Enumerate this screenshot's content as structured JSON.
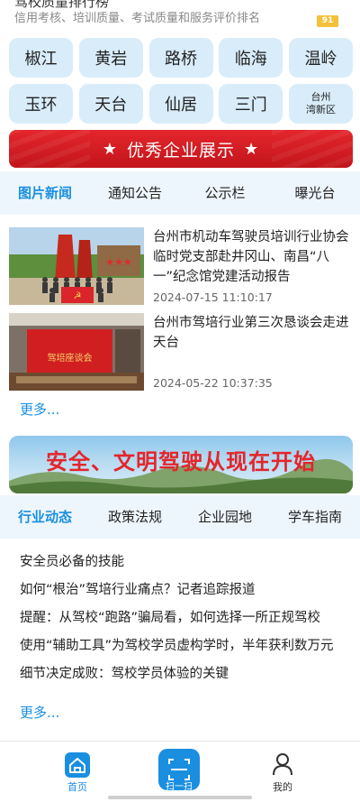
{
  "header": {
    "title": "驾校质量排行榜",
    "subtitle": "信用考核、培训质量、考试质量和服务评价排名",
    "badge": "91"
  },
  "regions": [
    {
      "label": "椒江"
    },
    {
      "label": "黄岩"
    },
    {
      "label": "路桥"
    },
    {
      "label": "临海"
    },
    {
      "label": "温岭"
    },
    {
      "label": "玉环"
    },
    {
      "label": "天台"
    },
    {
      "label": "仙居"
    },
    {
      "label": "三门"
    },
    {
      "label": "台州\n湾新区"
    }
  ],
  "showcase_banner": {
    "label": "优秀企业展示",
    "star": "★"
  },
  "news_tabs": [
    {
      "label": "图片新闻",
      "active": true
    },
    {
      "label": "通知公告",
      "active": false
    },
    {
      "label": "公示栏",
      "active": false
    },
    {
      "label": "曝光台",
      "active": false
    }
  ],
  "news": [
    {
      "title": "台州市机动车驾驶员培训行业协会临时党支部赴井冈山、南昌“八一”纪念馆党建活动报告",
      "date": "2024-07-15 11:10:17"
    },
    {
      "title": "台州市驾培行业第三次恳谈会走进天台",
      "date": "2024-05-22 10:37:35",
      "screen_text": "驾培座谈会"
    }
  ],
  "more_label": "更多...",
  "slogan_banner": {
    "text": "安全、文明驾驶从现在开始"
  },
  "industry_tabs": [
    {
      "label": "行业动态",
      "active": true
    },
    {
      "label": "政策法规",
      "active": false
    },
    {
      "label": "企业园地",
      "active": false
    },
    {
      "label": "学车指南",
      "active": false
    }
  ],
  "articles": [
    {
      "title": "安全员必备的技能"
    },
    {
      "title": "如何“根治”驾培行业痛点？记者追踪报道"
    },
    {
      "title": "提醒：从驾校“跑路”骗局看，如何选择一所正规驾校"
    },
    {
      "title": "使用“辅助工具”为驾校学员虚构学时，半年获利数万元"
    },
    {
      "title": "细节决定成败：驾校学员体验的关键"
    }
  ],
  "bottom_nav": {
    "home": {
      "label": "首页",
      "icon": "home-icon"
    },
    "scan": {
      "label": "扫一扫",
      "icon": "scan-icon"
    },
    "mine": {
      "label": "我的",
      "icon": "user-icon"
    }
  },
  "colors": {
    "accent": "#1a8fe0",
    "region_bg": "#d9ecfa",
    "banner_red": "#d61f25",
    "tab_bg": "#eef6fd"
  }
}
